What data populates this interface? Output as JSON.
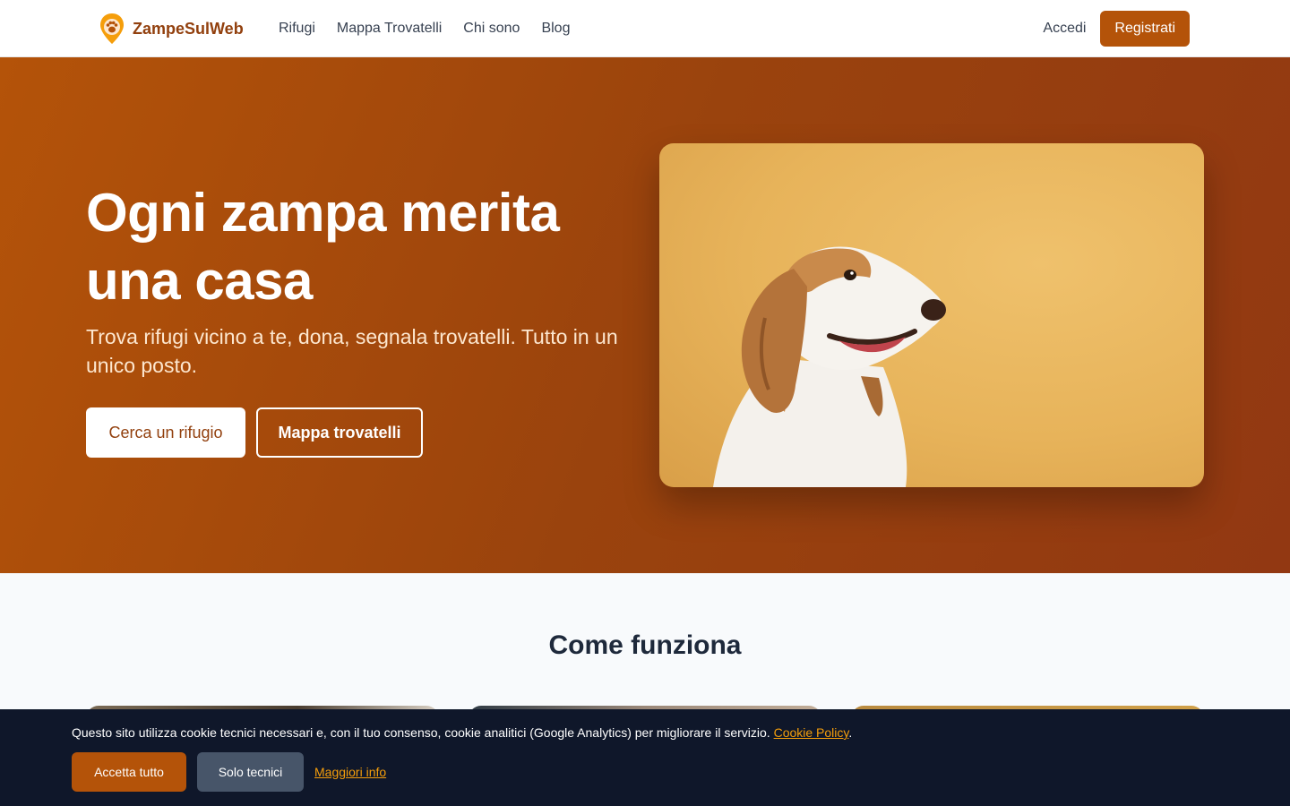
{
  "navbar": {
    "brand_name": "ZampeSulWeb",
    "links": [
      "Rifugi",
      "Mappa Trovatelli",
      "Chi sono",
      "Blog"
    ],
    "login_label": "Accedi",
    "register_label": "Registrati"
  },
  "hero": {
    "title": "Ogni zampa merita una casa",
    "subtitle": "Trova rifugi vicino a te, dona, segnala trovatelli. Tutto in un unico posto.",
    "primary_button": "Cerca un rifugio",
    "secondary_button": "Mappa trovatelli"
  },
  "how_it_works": {
    "title": "Come funziona"
  },
  "cookie_banner": {
    "text": "Questo sito utilizza cookie tecnici necessari e, con il tuo consenso, cookie analitici (Google Analytics) per migliorare il servizio.",
    "policy_link": "Cookie Policy",
    "trailing": ".",
    "accept_label": "Accetta tutto",
    "technical_label": "Solo tecnici",
    "more_info_label": "Maggiori info"
  },
  "colors": {
    "brand": "#b45309",
    "brand_dark": "#92400e",
    "hero_gradient_start": "#b45309",
    "hero_gradient_end": "#923812",
    "cookie_bg": "#0f172a",
    "link_accent": "#f59e0b"
  },
  "icons": {
    "brand_logo": "paw-location-pin-icon"
  }
}
